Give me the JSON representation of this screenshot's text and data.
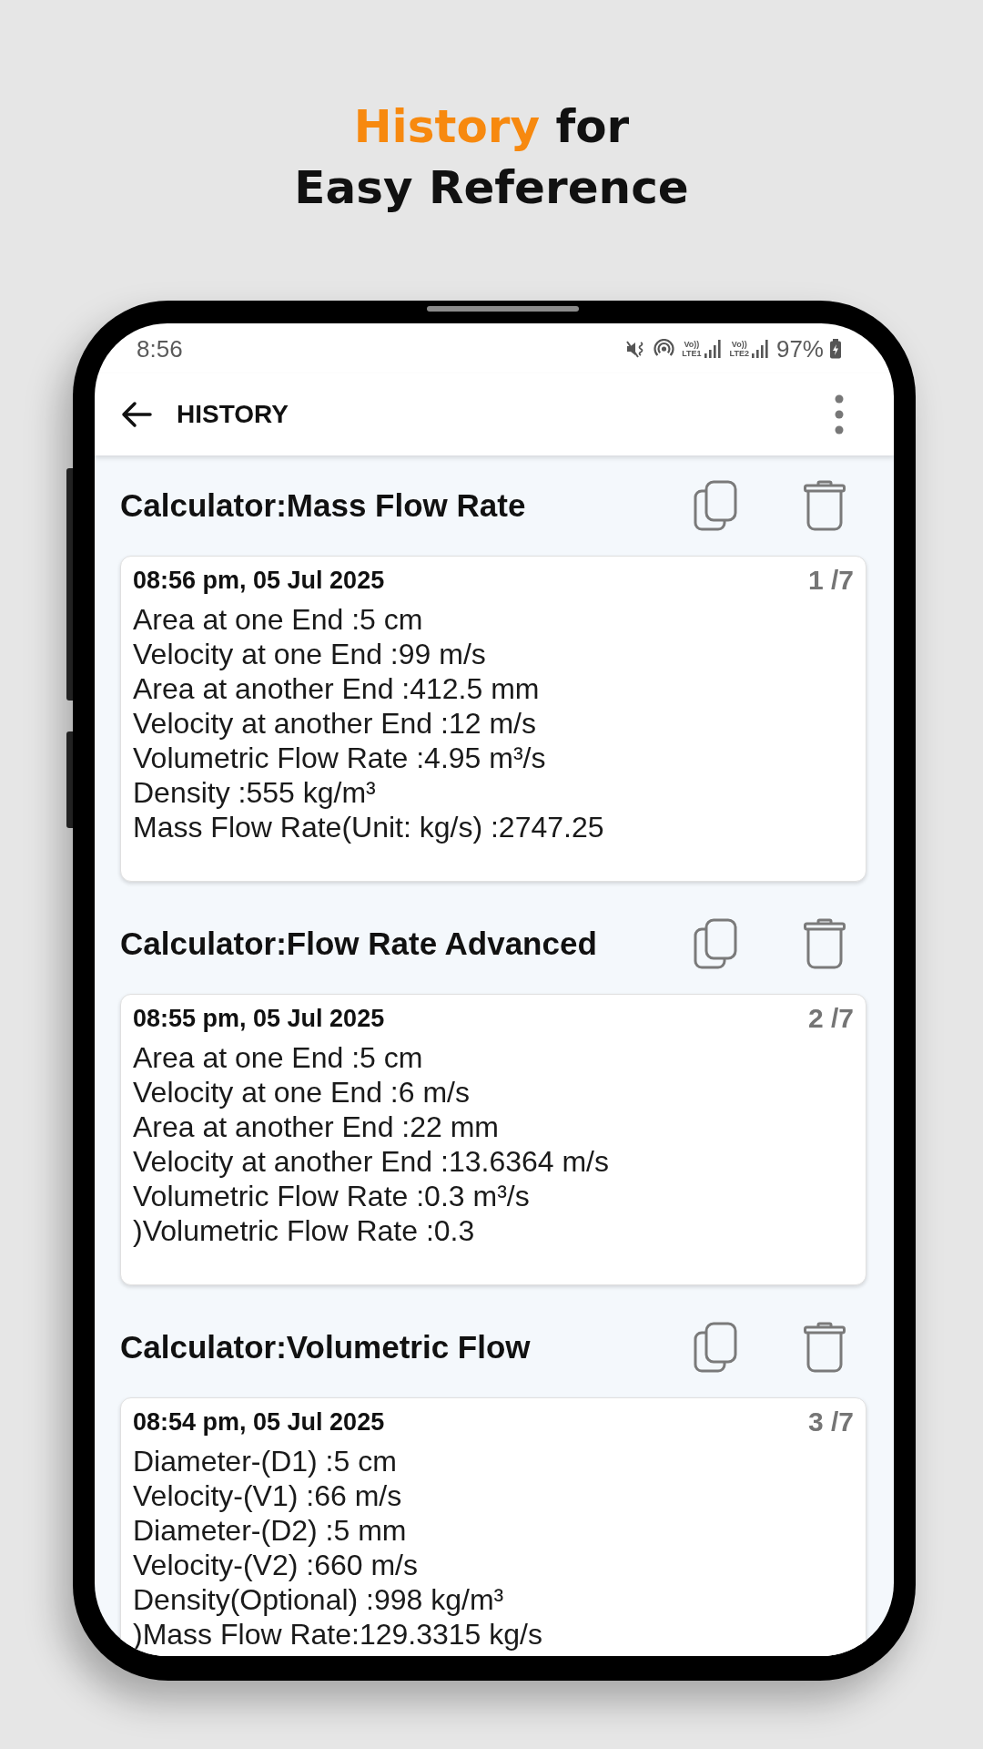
{
  "headline": {
    "lines": [
      [
        {
          "text": "History",
          "highlighted": true
        },
        {
          "text": "for",
          "highlighted": false
        }
      ],
      [
        {
          "text": "Easy Reference",
          "highlighted": false
        }
      ]
    ]
  },
  "status_bar": {
    "time": "8:56",
    "sims": [
      {
        "voice": "Vo))",
        "network": "LTE1"
      },
      {
        "voice": "Vo))",
        "network": "LTE2"
      }
    ],
    "battery": "97%"
  },
  "app_bar": {
    "title": "HISTORY"
  },
  "entries": [
    {
      "calculator": "Calculator:Mass Flow Rate",
      "timestamp": "08:56 pm, 05 Jul 2025",
      "position": "1 /7",
      "lines": [
        "Area at one End :5 cm",
        "Velocity at one End :99 m/s",
        "Area at another End :412.5 mm",
        "Velocity at another End :12 m/s",
        "Volumetric Flow Rate :4.95 m³/s",
        "Density :555 kg/m³",
        "Mass Flow Rate(Unit: kg/s) :2747.25"
      ]
    },
    {
      "calculator": "Calculator:Flow Rate Advanced",
      "timestamp": "08:55 pm, 05 Jul 2025",
      "position": "2 /7",
      "lines": [
        "Area at one End :5 cm",
        "Velocity at one End :6 m/s",
        "Area at another End :22 mm",
        "Velocity at another End :13.6364 m/s",
        "Volumetric Flow Rate :0.3 m³/s",
        ")Volumetric Flow Rate :0.3"
      ]
    },
    {
      "calculator": "Calculator:Volumetric Flow",
      "timestamp": "08:54 pm, 05 Jul 2025",
      "position": "3 /7",
      "lines": [
        "Diameter-(D1) :5 cm",
        "Velocity-(V1) :66 m/s",
        "Diameter-(D2) :5 mm",
        "Velocity-(V2) :660 m/s",
        "Density(Optional) :998 kg/m³",
        ")Mass Flow Rate:129.3315 kg/s"
      ]
    }
  ]
}
